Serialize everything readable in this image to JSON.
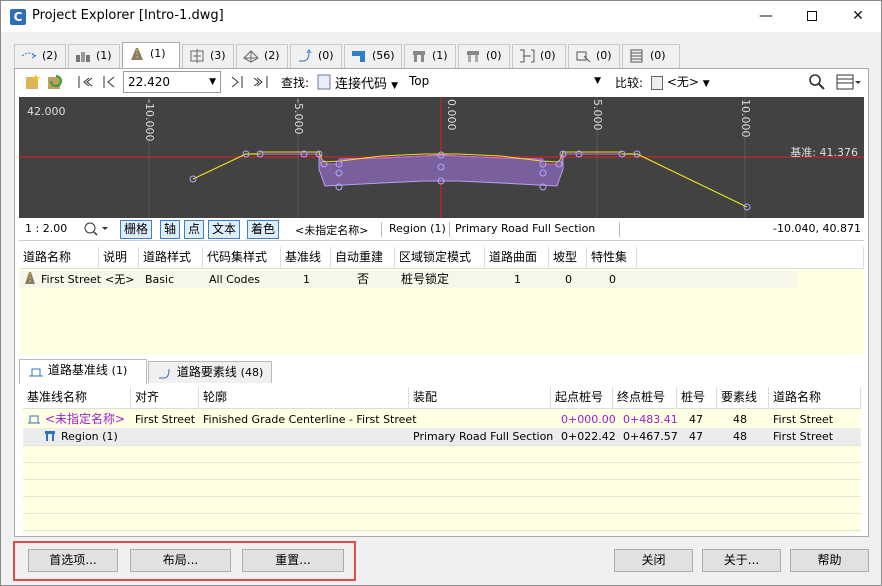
{
  "window": {
    "title": "Project Explorer [Intro-1.dwg]",
    "app_icon_letter": "C",
    "min_glyph": "—",
    "close_glyph": "✕"
  },
  "object_tabs": [
    {
      "count": "(2)",
      "icon": "alignment-icon"
    },
    {
      "count": "(1)",
      "icon": "profile-icon"
    },
    {
      "count": "(1)",
      "icon": "corridor-icon"
    },
    {
      "count": "(3)",
      "icon": "sample-line-icon"
    },
    {
      "count": "(2)",
      "icon": "surface-icon"
    },
    {
      "count": "(0)",
      "icon": "featureline-icon"
    },
    {
      "count": "(56)",
      "icon": "pipe-icon"
    },
    {
      "count": "(1)",
      "icon": "assembly-icon"
    },
    {
      "count": "(0)",
      "icon": "subassembly-icon"
    },
    {
      "count": "(0)",
      "icon": "parcel-icon"
    },
    {
      "count": "(0)",
      "icon": "point-icon"
    },
    {
      "count": "(0)",
      "icon": "table-icon"
    }
  ],
  "toolbar": {
    "station_value": "22.420",
    "find_label": "查找:",
    "find_value": "连接代码",
    "find_sub": "Top",
    "compare_label": "比较:",
    "compare_value": "<无>"
  },
  "viewport": {
    "elev_label": "42.000",
    "datum_label": "基准: 41.376",
    "ticks": [
      "-10.000",
      "-5.000",
      "0.000",
      "5.000",
      "10.000"
    ]
  },
  "view_status": {
    "scale": "1 : 2.00",
    "toggles": [
      "栅格",
      "轴",
      "点",
      "文本",
      "着色"
    ],
    "unnamed": "<未指定名称>",
    "region": "Region (1)",
    "assembly": "Primary Road Full Section",
    "coords": "-10.040, 40.871"
  },
  "corridor_table": {
    "headers": [
      "道路名称",
      "说明",
      "道路样式",
      "代码集样式",
      "基准线",
      "自动重建",
      "区域锁定模式",
      "道路曲面",
      "坡型",
      "特性集"
    ],
    "rows": [
      [
        "First Street",
        "<无>",
        "Basic",
        "All Codes",
        "1",
        "否",
        "桩号锁定",
        "1",
        "0",
        "0"
      ]
    ]
  },
  "lower_tabs": [
    {
      "label": "道路基准线",
      "count": "(1)"
    },
    {
      "label": "道路要素线",
      "count": "(48)"
    }
  ],
  "baseline_table": {
    "headers": [
      "基准线名称",
      "对齐",
      "轮廓",
      "装配",
      "起点桩号",
      "终点桩号",
      "桩号",
      "要素线",
      "道路名称"
    ],
    "rows": [
      [
        "<未指定名称>",
        "First Street",
        "Finished Grade Centerline - First Street",
        "",
        "0+000.00",
        "0+483.41",
        "47",
        "48",
        "First Street"
      ],
      [
        "Region (1)",
        "",
        "",
        "Primary Road Full Section",
        "0+022.42",
        "0+467.57",
        "47",
        "48",
        "First Street"
      ]
    ]
  },
  "buttons": {
    "preferences": "首选项...",
    "layout": "布局...",
    "reset": "重置...",
    "close": "关闭",
    "about": "关于...",
    "help": "帮助"
  },
  "colors": {
    "accent_highlight": "#e04a4a",
    "viewport_bg": "#424242",
    "baseline_red": "#e02020",
    "daylight_yellow": "#e8e020",
    "pavement_purple": "#9a6fd0",
    "grid_row_bg": "#ffffe4"
  }
}
